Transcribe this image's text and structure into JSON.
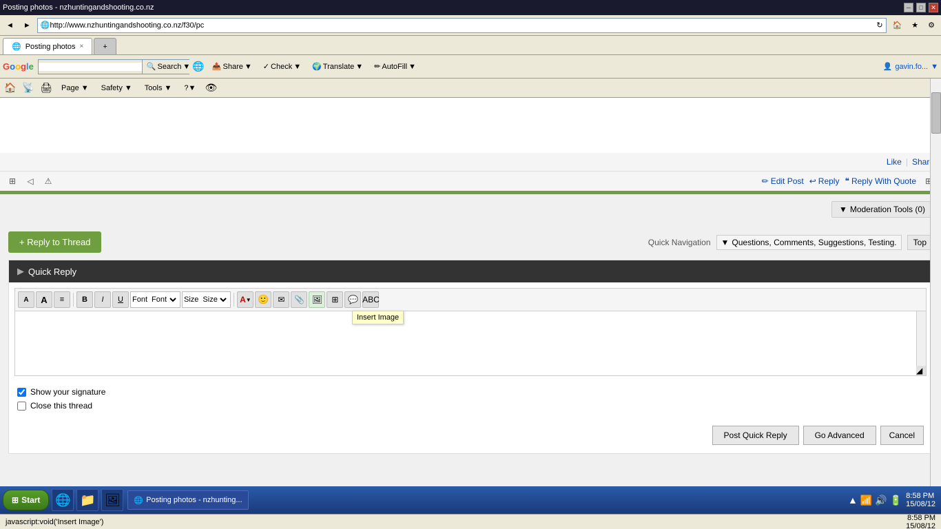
{
  "browser": {
    "title": "Posting photos - nzhuntingandshooting.co.nz",
    "url": "http://www.nzhuntingandshooting.co.nz/f30/pc",
    "tab_label": "Posting photos",
    "close_tab": "×",
    "nav_back": "◄",
    "nav_forward": "►"
  },
  "toolbar": {
    "google_label": "Google",
    "search_placeholder": "",
    "search_btn": "Search",
    "page_btn": "Page",
    "safety_btn": "Safety",
    "tools_btn": "Tools",
    "share_btn": "Share",
    "check_btn": "Check",
    "translate_btn": "Translate",
    "autofill_btn": "AutoFill",
    "user_label": "gavin.fo...",
    "user_dropdown": "▼"
  },
  "page_toolbar": {
    "page_btn": "Page ▼",
    "safety_btn": "Safety ▼",
    "tools_btn": "Tools ▼",
    "help_btn": "?▼"
  },
  "post": {
    "like_label": "Like",
    "share_label": "Share",
    "edit_post": "Edit Post",
    "reply": "Reply",
    "reply_with_quote": "Reply With Quote",
    "moderation_tools": "Moderation Tools (0)",
    "reply_to_thread": "+ Reply to Thread",
    "quick_nav_label": "Quick Navigation",
    "quick_nav_option": "Questions, Comments, Suggestions, Testing.",
    "top_btn": "Top"
  },
  "quick_reply": {
    "header": "Quick Reply",
    "font_label": "Font",
    "size_label": "Size",
    "tooltip": "Insert Image",
    "show_signature_label": "Show your signature",
    "close_thread_label": "Close this thread",
    "post_btn": "Post Quick Reply",
    "advanced_btn": "Go Advanced",
    "cancel_btn": "Cancel"
  },
  "status_bar": {
    "text": "javascript:void('Insert Image')",
    "time": "8:58 PM",
    "date": "15/08/12"
  },
  "taskbar": {
    "start_label": "Start",
    "ie_label": "Posting photos - nzhunting..."
  }
}
